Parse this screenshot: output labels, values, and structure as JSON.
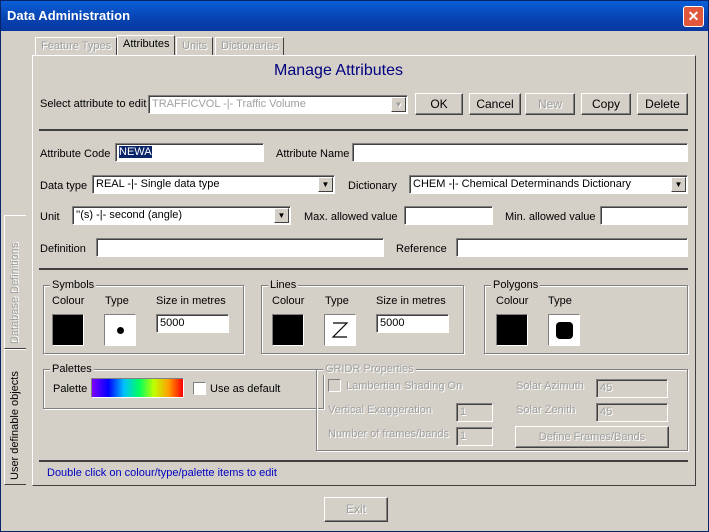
{
  "window": {
    "title": "Data Administration"
  },
  "tabs": [
    "Feature Types",
    "Attributes",
    "Units",
    "Dictionaries"
  ],
  "side_tabs": [
    "Database Definitions",
    "User definable objects"
  ],
  "header": {
    "title": "Manage Attributes"
  },
  "select_row": {
    "label": "Select attribute to edit",
    "value": "TRAFFICVOL -|- Traffic Volume",
    "buttons": {
      "ok": "OK",
      "cancel": "Cancel",
      "new": "New",
      "copy": "Copy",
      "delete": "Delete"
    }
  },
  "form": {
    "attribute_code_label": "Attribute Code",
    "attribute_code_value": "NEWA",
    "attribute_name_label": "Attribute Name",
    "attribute_name_value": "",
    "data_type_label": "Data type",
    "data_type_value": "REAL -|- Single data type",
    "dictionary_label": "Dictionary",
    "dictionary_value": "CHEM -|- Chemical Determinands Dictionary",
    "unit_label": "Unit",
    "unit_value": "''(s) -|- second (angle)",
    "max_label": "Max. allowed value",
    "max_value": "",
    "min_label": "Min. allowed value",
    "min_value": "",
    "definition_label": "Definition",
    "definition_value": "",
    "reference_label": "Reference",
    "reference_value": ""
  },
  "symbols": {
    "title": "Symbols",
    "colour_label": "Colour",
    "type_label": "Type",
    "size_label": "Size in metres",
    "size_value": "5000",
    "colour": "#000000"
  },
  "lines": {
    "title": "Lines",
    "colour_label": "Colour",
    "type_label": "Type",
    "size_label": "Size in metres",
    "size_value": "5000",
    "colour": "#000000"
  },
  "polygons": {
    "title": "Polygons",
    "colour_label": "Colour",
    "type_label": "Type",
    "colour": "#000000"
  },
  "palettes": {
    "title": "Palettes",
    "palette_label": "Palette",
    "use_default_label": "Use as default"
  },
  "gridr": {
    "title": "GRIDR Properties",
    "lambertian_label": "Lambertian Shading On",
    "vertical_label": "Vertical Exaggeration",
    "vertical_value": "1",
    "frames_label": "Number of frames/bands",
    "frames_value": "1",
    "azimuth_label": "Solar Azimuth",
    "azimuth_value": "45",
    "zenith_label": "Solar Zenith",
    "zenith_value": "45",
    "define_button": "Define Frames/Bands"
  },
  "hint": "Double click on colour/type/palette items to edit",
  "footer": {
    "exit": "Exit"
  }
}
